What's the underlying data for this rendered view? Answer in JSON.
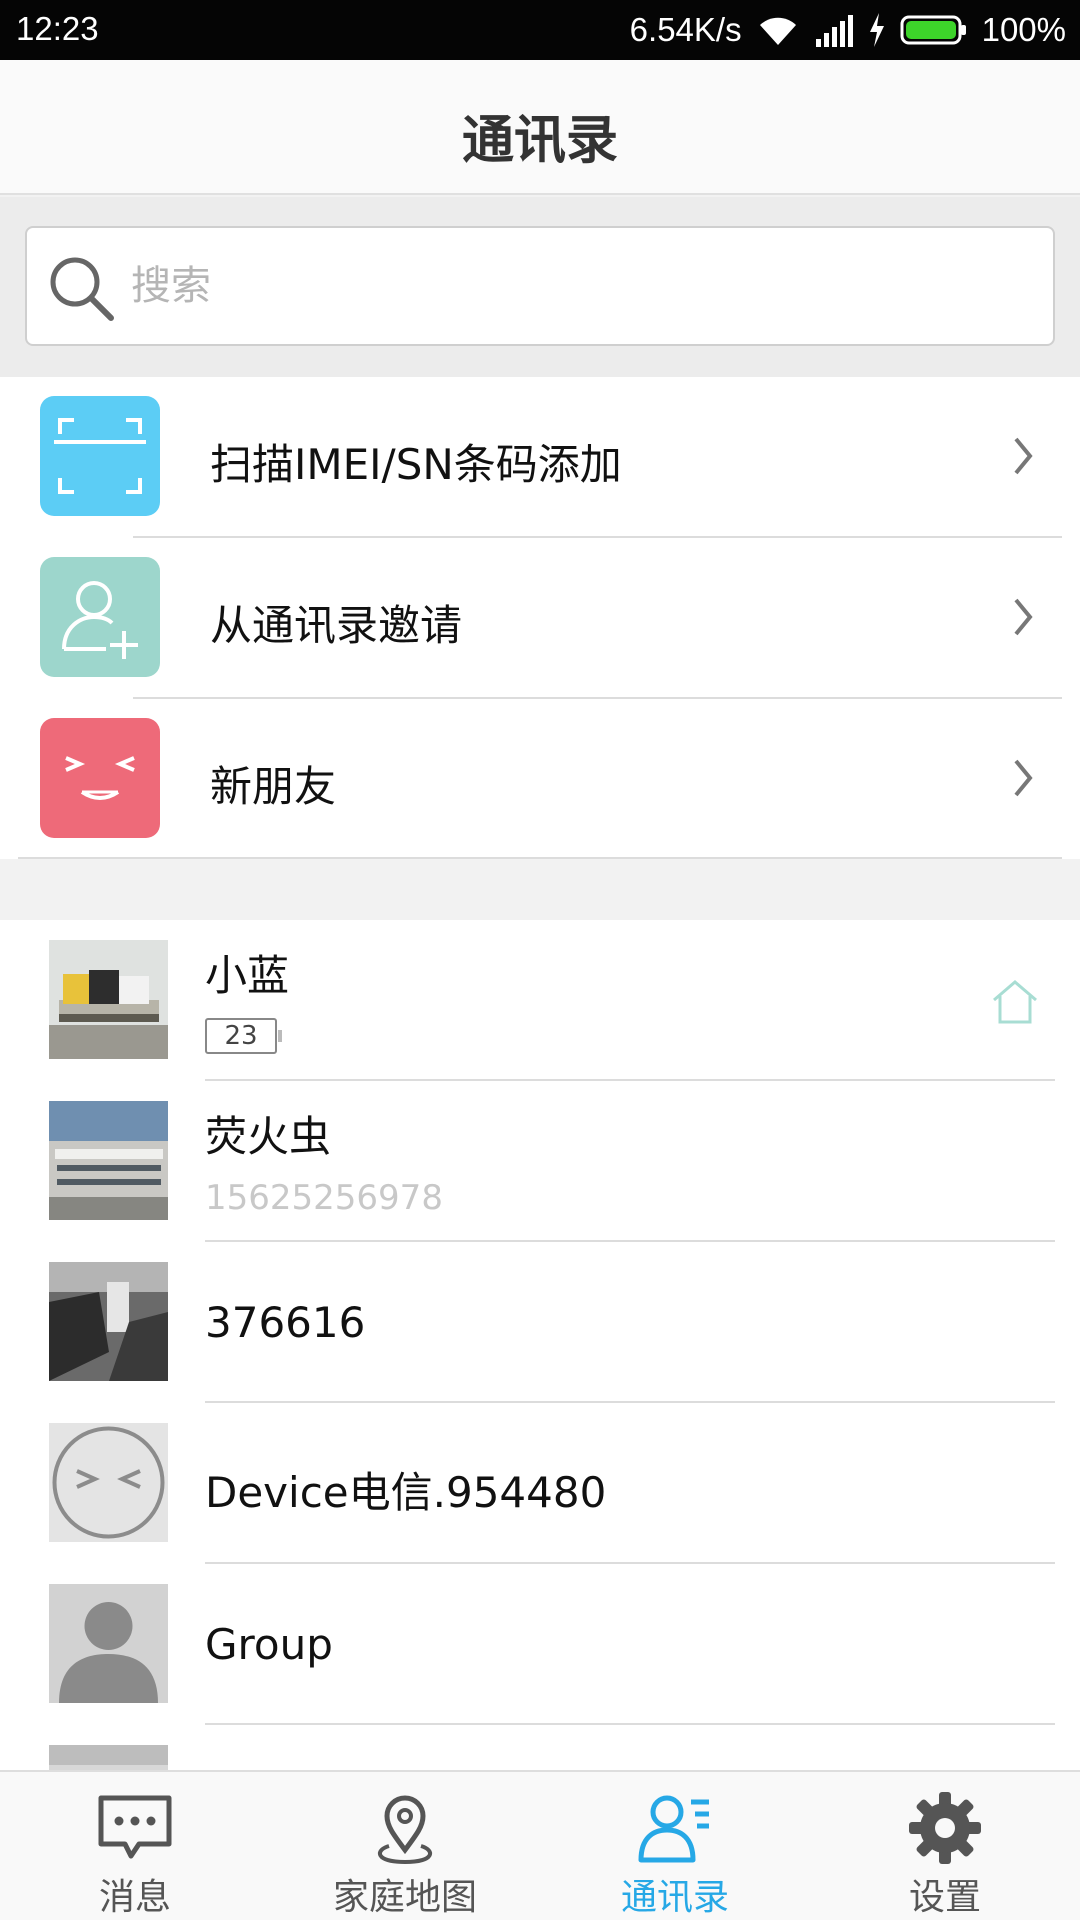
{
  "status_bar": {
    "time": "12:23",
    "network_speed": "6.54K/s",
    "battery": "100%"
  },
  "header": {
    "title": "通讯录"
  },
  "search": {
    "placeholder": "搜索"
  },
  "actions": [
    {
      "label": "扫描IMEI/SN条码添加",
      "icon": "scan-icon",
      "color": "#5ccdf5"
    },
    {
      "label": "从通讯录邀请",
      "icon": "add-contact-icon",
      "color": "#9dd6cc"
    },
    {
      "label": "新朋友",
      "icon": "smiley-icon",
      "color": "#ee6a79"
    }
  ],
  "contacts": [
    {
      "name": "小蓝",
      "battery_level": "23",
      "home_icon": "home-icon"
    },
    {
      "name": "荧火虫",
      "phone": "15625256978"
    },
    {
      "name": "376616"
    },
    {
      "name": "Device电信.954480"
    },
    {
      "name": "Group"
    }
  ],
  "bottom_nav": [
    {
      "label": "消息",
      "icon": "message-icon",
      "active": false
    },
    {
      "label": "家庭地图",
      "icon": "map-pin-icon",
      "active": false
    },
    {
      "label": "通讯录",
      "icon": "contacts-icon",
      "active": true
    },
    {
      "label": "设置",
      "icon": "gear-icon",
      "active": false
    }
  ],
  "colors": {
    "accent": "#26a8e6",
    "battery_green": "#3dd42a"
  }
}
